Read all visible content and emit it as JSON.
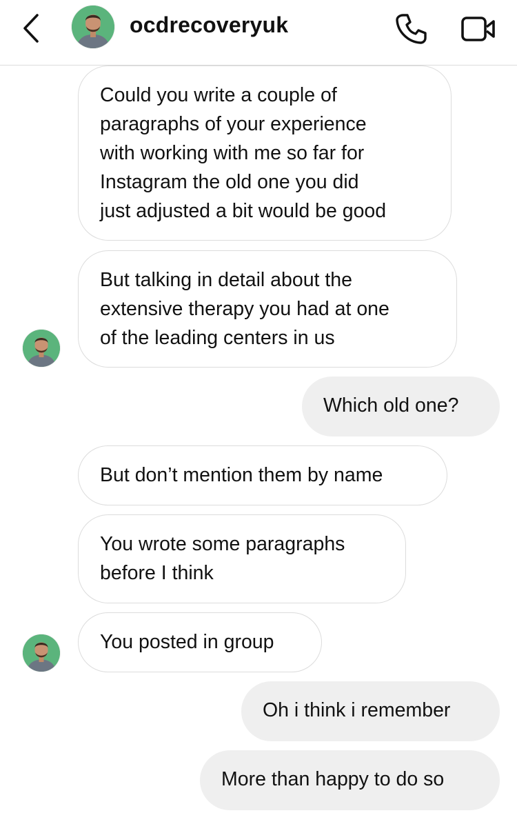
{
  "header": {
    "username": "ocdrecoveryuk",
    "icons": [
      "chevron-left-icon",
      "phone-icon",
      "video-camera-icon"
    ]
  },
  "messages": [
    {
      "side": "in",
      "text": "Could you write a couple of\nparagraphs of your experience\nwith working with me so far for\nInstagram the old one you did\njust adjusted a bit would be good"
    },
    {
      "side": "in",
      "text": "But talking in detail about the\nextensive therapy you had at one\nof the leading centers in us"
    },
    {
      "side": "out",
      "text": "Which old one?"
    },
    {
      "side": "in",
      "text": "But don’t mention them by name"
    },
    {
      "side": "in",
      "text": "You wrote some paragraphs\nbefore I think"
    },
    {
      "side": "in",
      "text": "You posted in group"
    },
    {
      "side": "out",
      "text": "Oh i think i remember"
    },
    {
      "side": "out",
      "text": "More than happy to do so"
    }
  ],
  "colors": {
    "outgoing_bubble": "#efefef",
    "incoming_border": "#dcdcdc",
    "text": "#111111"
  }
}
